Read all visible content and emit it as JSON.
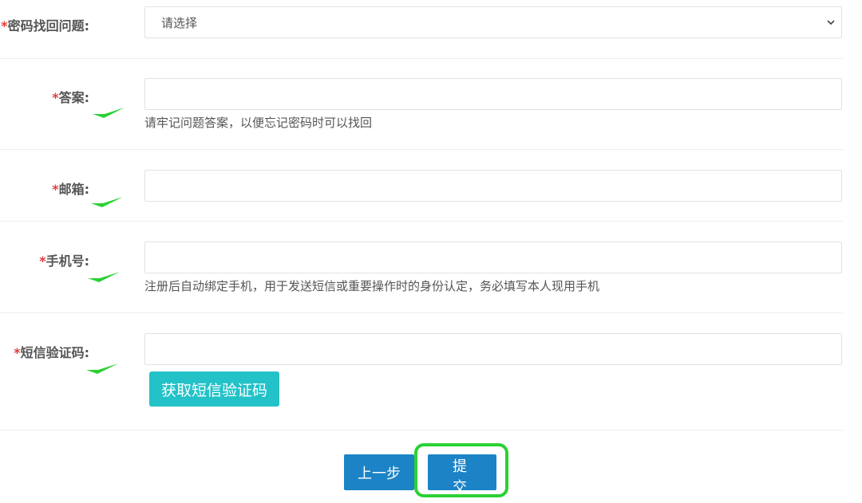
{
  "form": {
    "required_mark": "*",
    "question": {
      "label": "密码找回问题:",
      "selected": "请选择"
    },
    "answer": {
      "label": "答案:",
      "value": "",
      "hint": "请牢记问题答案，以便忘记密码时可以找回"
    },
    "email": {
      "label": "邮箱:",
      "value": ""
    },
    "phone": {
      "label": "手机号:",
      "value": "",
      "hint": "注册后自动绑定手机，用于发送短信或重要操作时的身份认定，务必填写本人现用手机"
    },
    "sms": {
      "label": "短信验证码:",
      "value": "",
      "button_label": "获取短信验证码"
    }
  },
  "actions": {
    "prev_label": "上一步",
    "submit_label": "提 交"
  },
  "colors": {
    "required": "#e03b3b",
    "check": "#2bd135",
    "sms_button": "#23c2c8",
    "primary_button": "#1c83c6",
    "highlight": "#2bd135"
  },
  "icons": {
    "check": "check-icon",
    "chevron": "chevron-down-icon"
  }
}
